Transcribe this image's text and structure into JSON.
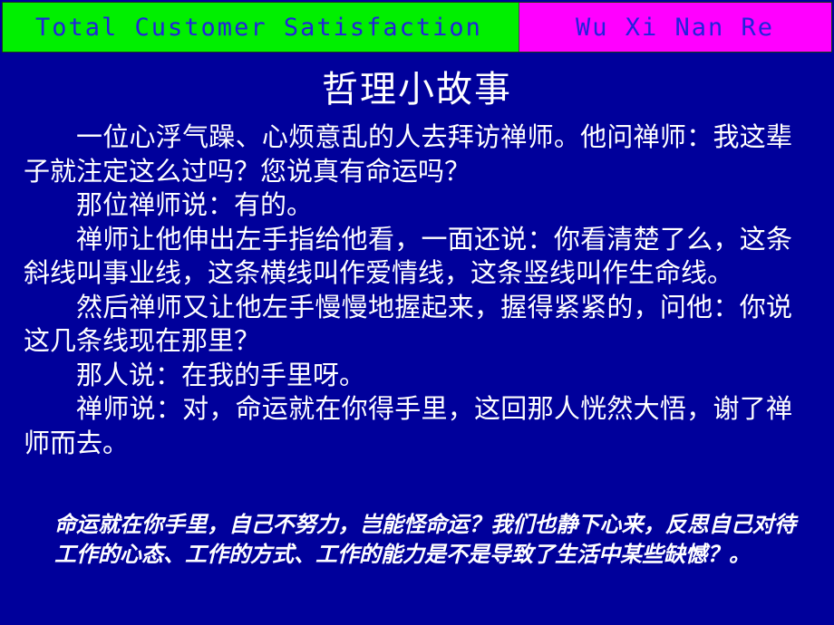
{
  "slide": {
    "background_color": "#00009B",
    "text_color": "#FFFFFF"
  },
  "banner": {
    "left": {
      "text": "Total  Customer  Satisfaction",
      "background_color": "#00F000",
      "text_color": "#2222DD"
    },
    "right": {
      "text": "Wu  Xi  Nan  Re",
      "background_color": "#FF00FF",
      "text_color": "#2222DD"
    }
  },
  "title": "哲理小故事",
  "story": {
    "paragraphs": [
      "一位心浮气躁、心烦意乱的人去拜访禅师。他问禅师：我这辈子就注定这么过吗？您说真有命运吗？",
      "那位禅师说：有的。",
      "禅师让他伸出左手指给他看，一面还说：你看清楚了么，这条斜线叫事业线，这条横线叫作爱情线，这条竖线叫作生命线。",
      "然后禅师又让他左手慢慢地握起来，握得紧紧的，问他：你说这几条线现在那里？",
      "那人说：在我的手里呀。",
      "禅师说：对，命运就在你得手里，这回那人恍然大悟，谢了禅师而去。"
    ]
  },
  "conclusion": {
    "text": "命运就在你手里，自己不努力，岂能怪命运？我们也静下心来，反思自己对待工作的心态、工作的方式、工作的能力是不是导致了生活中某些缺憾？。"
  }
}
